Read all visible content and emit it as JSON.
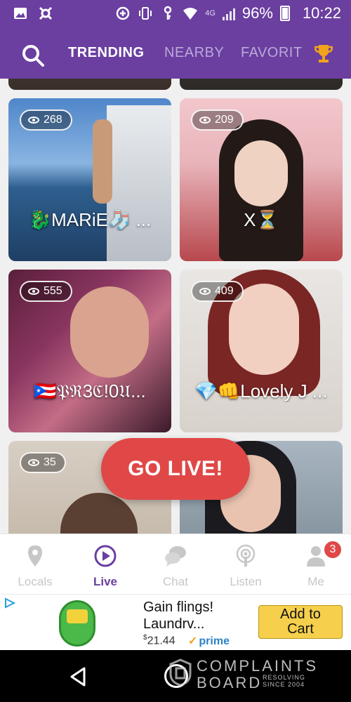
{
  "status_bar": {
    "battery": "96%",
    "time": "10:22",
    "network": "4G"
  },
  "header": {
    "tabs": [
      {
        "label": "TRENDING",
        "active": true
      },
      {
        "label": "NEARBY",
        "active": false
      },
      {
        "label": "FAVORIT",
        "active": false
      }
    ],
    "icons": [
      "search-icon",
      "trophy-icon"
    ]
  },
  "streams": [
    {
      "viewers": "268",
      "name": "🐉MARiE🧦 ..."
    },
    {
      "viewers": "209",
      "name": "X⏳"
    },
    {
      "viewers": "555",
      "name": "🇵🇷𝔓ℜ3ℭ!0𝔘..."
    },
    {
      "viewers": "409",
      "name": "💎👊Lovely J ..."
    },
    {
      "viewers": "35",
      "name": ""
    },
    {
      "viewers": "",
      "name": ""
    }
  ],
  "go_live": {
    "label": "GO LIVE!"
  },
  "bottom_nav": [
    {
      "label": "Locals",
      "icon": "location-pin-icon",
      "active": false
    },
    {
      "label": "Live",
      "icon": "play-circle-icon",
      "active": true
    },
    {
      "label": "Chat",
      "icon": "chat-bubbles-icon",
      "active": false
    },
    {
      "label": "Listen",
      "icon": "podcast-icon",
      "active": false
    },
    {
      "label": "Me",
      "icon": "person-icon",
      "active": false,
      "badge": "3"
    }
  ],
  "ad": {
    "title_line1": "Gain flings!",
    "title_line2": "Laundrv...",
    "price_symbol": "$",
    "price": "21.44",
    "prime": "prime",
    "cta_line1": "Add to",
    "cta_line2": "Cart"
  },
  "watermark": {
    "line1": "COMPLAINTS",
    "line2": "BOARD",
    "tag_line1": "RESOLVING",
    "tag_line2": "SINCE 2004"
  },
  "colors": {
    "header": "#6a3fa0",
    "accent": "#6a3fa0",
    "go_live": "#e04848",
    "badge": "#e04848"
  }
}
